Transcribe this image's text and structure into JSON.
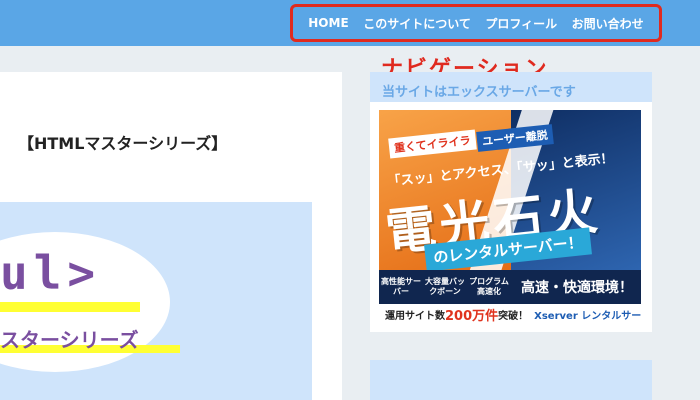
{
  "nav": {
    "items": [
      {
        "label": "HOME"
      },
      {
        "label": "このサイトについて"
      },
      {
        "label": "プロフィール"
      },
      {
        "label": "お問い合わせ"
      }
    ]
  },
  "annotation": "ナビゲーション",
  "post": {
    "title": "【HTMLマスターシリーズ】",
    "thumbnail_tag": "ul>",
    "thumbnail_series": "スターシリーズ"
  },
  "sidebar": {
    "heading": "当サイトはエックスサーバーです"
  },
  "ad": {
    "tag1": "重くてイライラ",
    "tag2": "ユーザー離脱",
    "catch": "「スッ」とアクセス、「サッ」と表示！",
    "big": "電光石火",
    "strip": "のレンタルサーバー！",
    "features": [
      "高性能サーバー",
      "大容量バックボーン",
      "プログラム高速化"
    ],
    "environment": "高速・快適環境！",
    "bottom_prefix": "運用サイト数",
    "bottom_number": "200万件",
    "bottom_suffix": "突破！",
    "brand": "Xserver レンタルサーバー"
  }
}
